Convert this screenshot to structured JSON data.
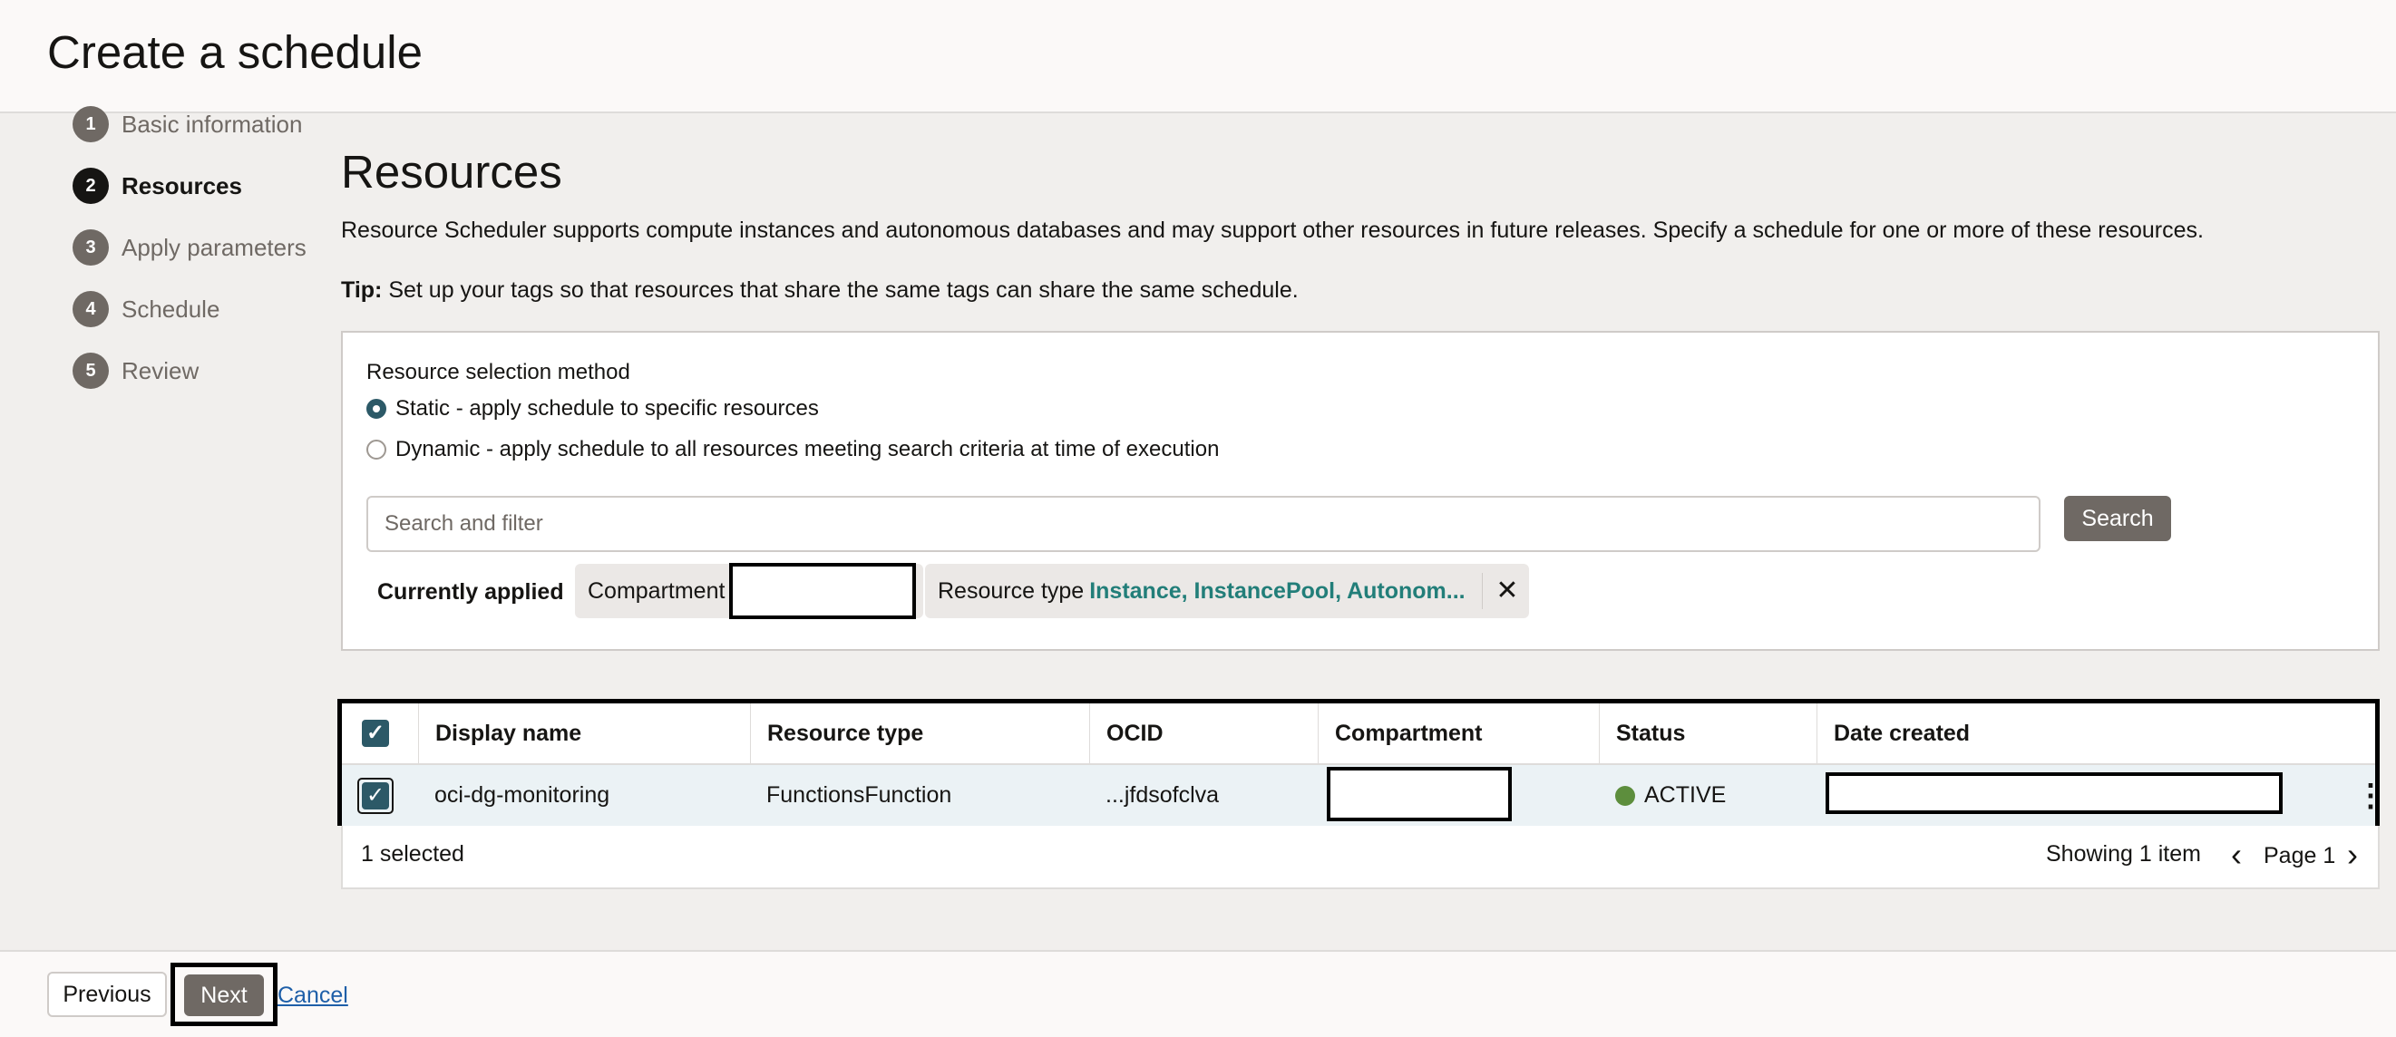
{
  "header": {
    "title": "Create a schedule"
  },
  "steps": [
    {
      "num": "1",
      "label": "Basic information"
    },
    {
      "num": "2",
      "label": "Resources"
    },
    {
      "num": "3",
      "label": "Apply parameters"
    },
    {
      "num": "4",
      "label": "Schedule"
    },
    {
      "num": "5",
      "label": "Review"
    }
  ],
  "main": {
    "title": "Resources",
    "description": "Resource Scheduler supports compute instances and autonomous databases and may support other resources in future releases. Specify a schedule for one or more of these resources.",
    "tip_label": "Tip:",
    "tip_text": " Set up your tags so that resources that share the same tags can share the same schedule."
  },
  "selection": {
    "label": "Resource selection method",
    "options": [
      {
        "label": "Static - apply schedule to specific resources",
        "checked": true
      },
      {
        "label": "Dynamic - apply schedule to all resources meeting search criteria at time of execution",
        "checked": false
      }
    ]
  },
  "search": {
    "placeholder": "Search and filter",
    "button": "Search"
  },
  "filters": {
    "label": "Currently applied",
    "compartment_label": "Compartment",
    "type_label": "Resource type",
    "type_value": "Instance, InstancePool, Autonom...",
    "close_icon": "close-icon"
  },
  "table": {
    "columns": [
      "Display name",
      "Resource type",
      "OCID",
      "Compartment",
      "Status",
      "Date created"
    ],
    "rows": [
      {
        "display_name": "oci-dg-monitoring",
        "resource_type": "FunctionsFunction",
        "ocid": "...jfdsofclva",
        "compartment": "",
        "status": "ACTIVE",
        "date_created": ""
      }
    ],
    "selected_count": "1 selected",
    "showing": "Showing 1 item",
    "page": "Page 1"
  },
  "footer": {
    "previous": "Previous",
    "next": "Next",
    "cancel": "Cancel"
  },
  "colors": {
    "status_active": "#5d8e3d",
    "checkbox": "#2c5967",
    "filter_value": "#227e79",
    "primary_button": "#6f6964"
  }
}
